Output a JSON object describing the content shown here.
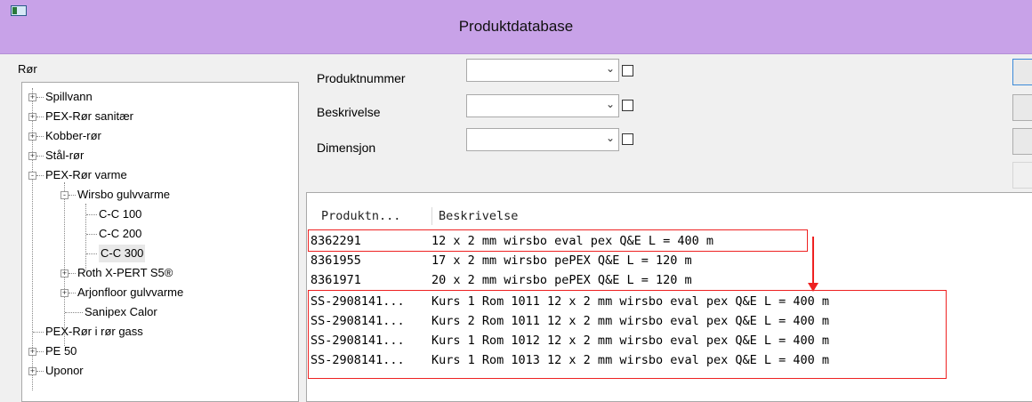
{
  "window": {
    "title": "Produktdatabase",
    "icon": "app-window-icon"
  },
  "tree": {
    "label": "Rør",
    "nodes": [
      {
        "label": "Spillvann",
        "expander": "+"
      },
      {
        "label": "PEX-Rør sanitær",
        "expander": "+"
      },
      {
        "label": "Kobber-rør",
        "expander": "+"
      },
      {
        "label": "Stål-rør",
        "expander": "+"
      },
      {
        "label": "PEX-Rør varme",
        "expander": "-"
      },
      {
        "label": "Wirsbo gulvvarme",
        "expander": "-"
      },
      {
        "label": "C-C 100"
      },
      {
        "label": "C-C 200"
      },
      {
        "label": "C-C 300",
        "selected": true
      },
      {
        "label": "Roth X-PERT S5®",
        "expander": "+"
      },
      {
        "label": "Arjonfloor gulvvarme",
        "expander": "+"
      },
      {
        "label": "Sanipex Calor"
      },
      {
        "label": "PEX-Rør i rør gass"
      },
      {
        "label": "PE 50",
        "expander": "+"
      },
      {
        "label": "Uponor",
        "expander": "+"
      }
    ]
  },
  "filters": [
    {
      "label": "Produktnummer",
      "value": "",
      "checked": false
    },
    {
      "label": "Beskrivelse",
      "value": "",
      "checked": false
    },
    {
      "label": "Dimensjon",
      "value": "",
      "checked": false
    }
  ],
  "list": {
    "columns": [
      "Produktn...",
      "Beskrivelse"
    ],
    "rows": [
      {
        "nr": "8362291",
        "desc": "12 x 2 mm wirsbo eval pex Q&E L = 400 m"
      },
      {
        "nr": "8361955",
        "desc": "17 x 2 mm wirsbo pePEX Q&E L = 120 m"
      },
      {
        "nr": "8361971",
        "desc": "20 x 2 mm wirsbo pePEX Q&E L = 120 m"
      },
      {
        "nr": "SS-2908141...",
        "desc": "Kurs 1 Rom 1011 12 x 2 mm wirsbo eval pex Q&E L = 400 m"
      },
      {
        "nr": "SS-2908141...",
        "desc": "Kurs 2 Rom 1011 12 x 2 mm wirsbo eval pex Q&E L = 400 m"
      },
      {
        "nr": "SS-2908141...",
        "desc": "Kurs 1 Rom 1012 12 x 2 mm wirsbo eval pex Q&E L = 400 m"
      },
      {
        "nr": "SS-2908141...",
        "desc": "Kurs 1 Rom 1013 12 x 2 mm wirsbo eval pex Q&E L = 400 m"
      }
    ]
  },
  "colors": {
    "titlebar": "#c8a2e8",
    "annotation": "#e22222"
  }
}
